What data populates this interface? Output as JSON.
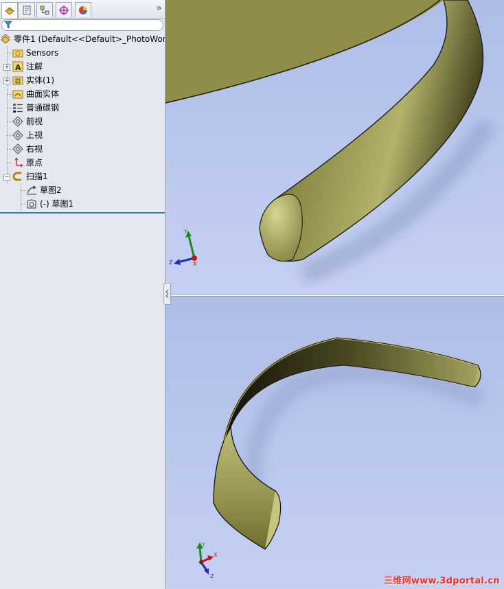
{
  "panel": {
    "tabs": [
      {
        "icon": "feature-manager-icon"
      },
      {
        "icon": "property-manager-icon"
      },
      {
        "icon": "configuration-manager-icon"
      },
      {
        "icon": "dimxpert-icon"
      },
      {
        "icon": "display-manager-icon"
      }
    ],
    "collapse_glyph": "»",
    "tree": {
      "root": "零件1  (Default<<Default>_PhotoWorl",
      "items": [
        {
          "label": "Sensors",
          "icon": "sensors-folder-icon"
        },
        {
          "label": "注解",
          "icon": "annotations-icon"
        },
        {
          "label": "实体(1)",
          "icon": "solid-bodies-icon"
        },
        {
          "label": "曲面实体",
          "icon": "surface-bodies-icon"
        },
        {
          "label": "普通碳钢",
          "icon": "material-icon"
        },
        {
          "label": "前视",
          "icon": "plane-icon"
        },
        {
          "label": "上视",
          "icon": "plane-icon"
        },
        {
          "label": "右视",
          "icon": "plane-icon"
        },
        {
          "label": "原点",
          "icon": "origin-icon"
        },
        {
          "label": "扫描1",
          "icon": "sweep-feature-icon"
        },
        {
          "label": "草图2",
          "icon": "sketch-icon"
        },
        {
          "label": "(-) 草图1",
          "icon": "sketch-icon"
        }
      ]
    }
  },
  "viewports": {
    "top": {
      "triad": {
        "labels": [
          "Y",
          "Z",
          "X"
        ]
      }
    },
    "bottom": {
      "triad": {
        "labels": [
          "Y",
          "X",
          "Z"
        ]
      }
    }
  },
  "colors": {
    "model": "#a3a35a",
    "background": "#b8c5ee",
    "axis_x": "#cc1111",
    "axis_y": "#1c8a1c",
    "axis_z": "#1f2fb0"
  },
  "watermark": "三维网www.3dportal.cn"
}
